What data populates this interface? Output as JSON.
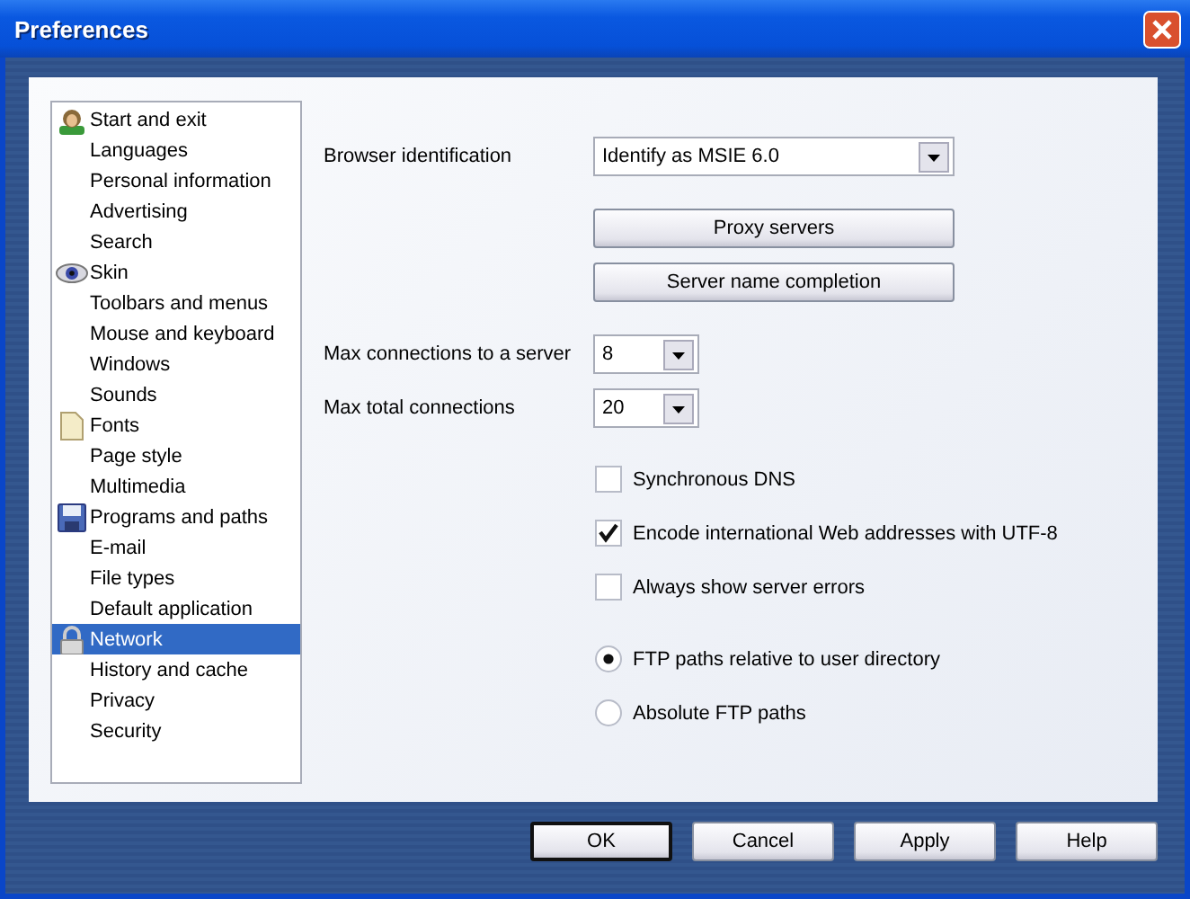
{
  "window": {
    "title": "Preferences"
  },
  "sidebar": {
    "items": [
      {
        "label": "Start and exit",
        "kind": "person",
        "selected": false
      },
      {
        "label": "Languages",
        "kind": "plain",
        "selected": false
      },
      {
        "label": "Personal information",
        "kind": "plain",
        "selected": false
      },
      {
        "label": "Advertising",
        "kind": "plain",
        "selected": false
      },
      {
        "label": "Search",
        "kind": "plain",
        "selected": false
      },
      {
        "label": "Skin",
        "kind": "eye",
        "selected": false
      },
      {
        "label": "Toolbars and menus",
        "kind": "plain",
        "selected": false
      },
      {
        "label": "Mouse and keyboard",
        "kind": "plain",
        "selected": false
      },
      {
        "label": "Windows",
        "kind": "plain",
        "selected": false
      },
      {
        "label": "Sounds",
        "kind": "plain",
        "selected": false
      },
      {
        "label": "Fonts",
        "kind": "page",
        "selected": false
      },
      {
        "label": "Page style",
        "kind": "plain",
        "selected": false
      },
      {
        "label": "Multimedia",
        "kind": "plain",
        "selected": false
      },
      {
        "label": "Programs and paths",
        "kind": "disk",
        "selected": false
      },
      {
        "label": "E-mail",
        "kind": "plain",
        "selected": false
      },
      {
        "label": "File types",
        "kind": "plain",
        "selected": false
      },
      {
        "label": "Default application",
        "kind": "plain",
        "selected": false
      },
      {
        "label": "Network",
        "kind": "lock",
        "selected": true
      },
      {
        "label": "History and cache",
        "kind": "plain",
        "selected": false
      },
      {
        "label": "Privacy",
        "kind": "plain",
        "selected": false
      },
      {
        "label": "Security",
        "kind": "plain",
        "selected": false
      }
    ]
  },
  "browser_identification": {
    "label": "Browser identification",
    "value": "Identify as MSIE 6.0"
  },
  "buttons": [
    "Proxy servers",
    "Server name completion"
  ],
  "connections": [
    {
      "label": "Max connections to a server",
      "value": "8"
    },
    {
      "label": "Max total connections",
      "value": "20"
    }
  ],
  "checkboxes": [
    {
      "label": "Synchronous DNS",
      "checked": false
    },
    {
      "label": "Encode international Web addresses with UTF-8",
      "checked": true
    },
    {
      "label": "Always show server errors",
      "checked": false
    }
  ],
  "radios": [
    {
      "label": "FTP paths relative to user directory",
      "selected": true
    },
    {
      "label": "Absolute FTP paths",
      "selected": false
    }
  ],
  "footer_buttons": [
    {
      "label": "OK",
      "default": true
    },
    {
      "label": "Cancel",
      "default": false
    },
    {
      "label": "Apply",
      "default": false
    },
    {
      "label": "Help",
      "default": false
    }
  ]
}
